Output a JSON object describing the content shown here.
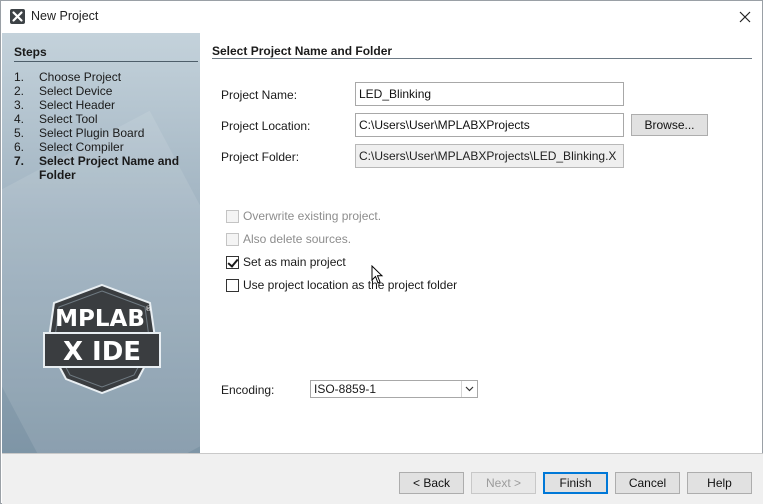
{
  "window": {
    "title": "New Project",
    "icon": "mplab-x-icon",
    "close_icon": "close-icon"
  },
  "steps": {
    "header": "Steps",
    "items": [
      {
        "num": "1.",
        "label": "Choose Project",
        "active": false
      },
      {
        "num": "2.",
        "label": "Select Device",
        "active": false
      },
      {
        "num": "3.",
        "label": "Select Header",
        "active": false
      },
      {
        "num": "4.",
        "label": "Select Tool",
        "active": false
      },
      {
        "num": "5.",
        "label": "Select Plugin Board",
        "active": false
      },
      {
        "num": "6.",
        "label": "Select Compiler",
        "active": false
      },
      {
        "num": "7.",
        "label": "Select Project Name and Folder",
        "active": true
      }
    ],
    "logo": {
      "line1": "MPLAB",
      "registered": "®",
      "line2": "X IDE"
    }
  },
  "main": {
    "title": "Select Project Name and Folder",
    "project_name_label": "Project Name:",
    "project_name_value": "LED_Blinking",
    "project_location_label": "Project Location:",
    "project_location_value": "C:\\Users\\User\\MPLABXProjects",
    "browse_label": "Browse...",
    "project_folder_label": "Project Folder:",
    "project_folder_value": "C:\\Users\\User\\MPLABXProjects\\LED_Blinking.X",
    "options": {
      "overwrite_label": "Overwrite existing project.",
      "overwrite_checked": false,
      "overwrite_enabled": false,
      "delete_sources_label": "Also delete sources.",
      "delete_sources_checked": false,
      "delete_sources_enabled": false,
      "set_main_label": "Set as main project",
      "set_main_checked": true,
      "use_location_label": "Use project location as the project folder",
      "use_location_checked": false
    },
    "encoding_label": "Encoding:",
    "encoding_value": "ISO-8859-1"
  },
  "footer": {
    "back_label": "< Back",
    "next_label": "Next >",
    "finish_label": "Finish",
    "cancel_label": "Cancel",
    "help_label": "Help"
  },
  "colors": {
    "accent": "#0078d7",
    "panel_top": "#c4d2db",
    "panel_bottom": "#7e95a6",
    "logo_dark": "#3a3d40"
  }
}
